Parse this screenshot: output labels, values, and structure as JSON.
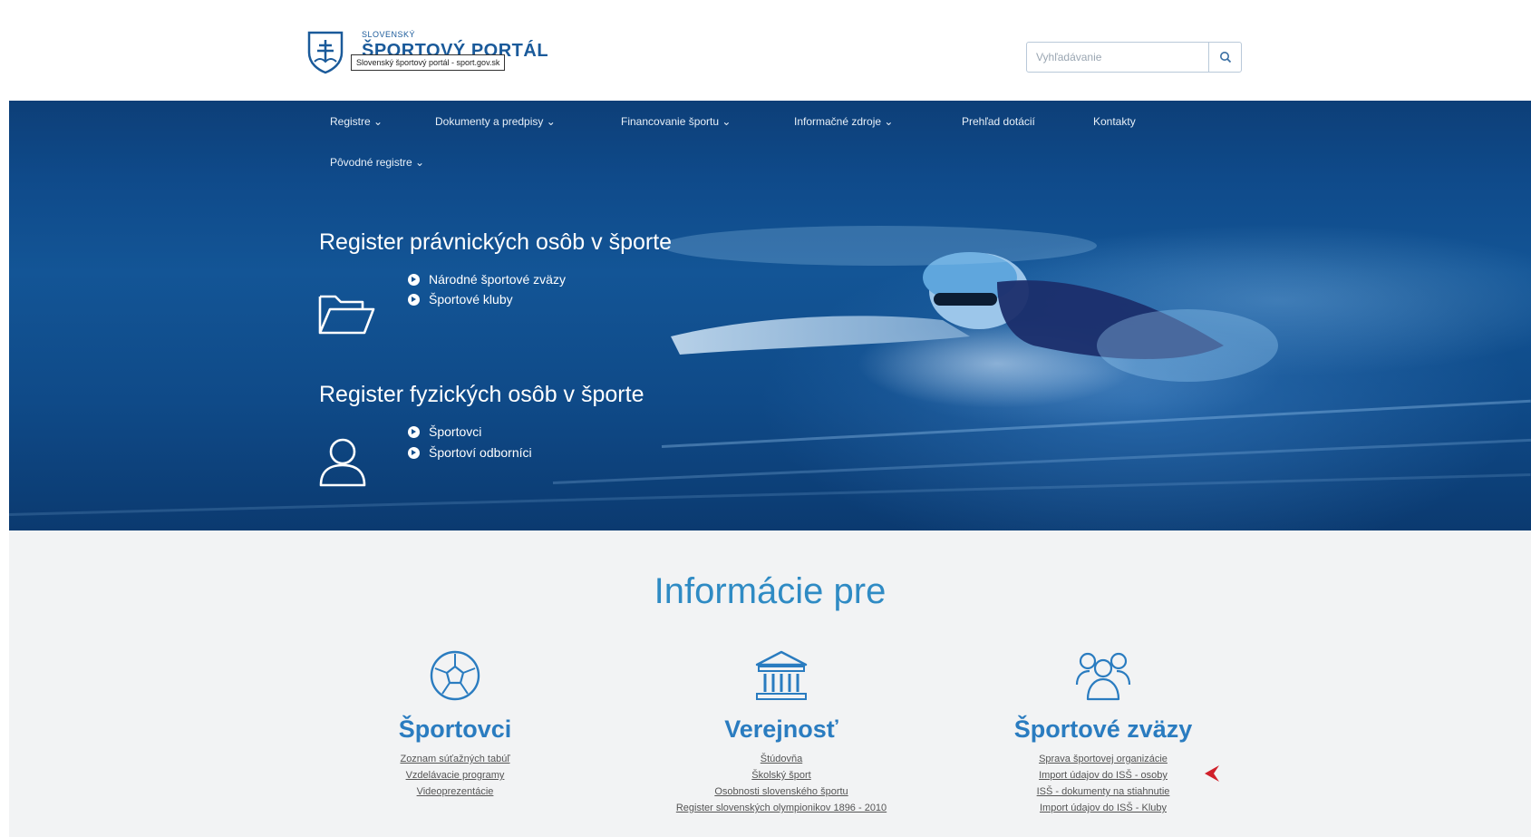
{
  "header": {
    "logo_small": "SLOVENSKÝ",
    "logo_big": "ŠPORTOVÝ PORTÁL",
    "logo_tooltip": "Slovenský športový portál - sport.gov.sk",
    "search_placeholder": "Vyhľadávanie",
    "search_icon": "search-icon"
  },
  "nav": {
    "items": [
      {
        "label": "Registre ⌄"
      },
      {
        "label": "Dokumenty a predpisy ⌄"
      },
      {
        "label": "Financovanie športu ⌄"
      },
      {
        "label": "Informačné zdroje ⌄"
      },
      {
        "label": "Prehľad dotácií"
      },
      {
        "label": "Kontakty"
      },
      {
        "label": "Pôvodné registre ⌄"
      }
    ]
  },
  "hero": {
    "legal": {
      "title": "Register právnických osôb v športe",
      "icon": "folder-open-icon",
      "links": [
        "Národné športové zväzy",
        "Športové kluby"
      ]
    },
    "natural": {
      "title": "Register fyzických osôb v športe",
      "icon": "user-icon",
      "links": [
        "Športovci",
        "Športoví odborníci"
      ]
    }
  },
  "info": {
    "heading": "Informácie pre",
    "columns": [
      {
        "icon": "soccer-ball-icon",
        "title": "Športovci",
        "links": [
          "Zoznam súťažných tabúľ",
          "Vzdelávacie programy",
          "Videoprezentácie"
        ]
      },
      {
        "icon": "institution-icon",
        "title": "Verejnosť",
        "links": [
          "Štúdovňa",
          "Školský šport",
          "Osobnosti slovenského športu",
          "Register slovenských olympionikov 1896 - 2010"
        ]
      },
      {
        "icon": "group-icon",
        "title": "Športové zväzy",
        "links": [
          "Sprava športovej organizácie",
          "Import údajov do ISŠ - osoby",
          "ISŠ - dokumenty na stiahnutie",
          "Import údajov do ISŠ - Kluby"
        ]
      }
    ],
    "accent_color": "#2a7cc0",
    "marker_color": "#d0202a"
  },
  "colors": {
    "nav_bg": "#0f4a8a",
    "info_bg": "#f2f3f4"
  }
}
